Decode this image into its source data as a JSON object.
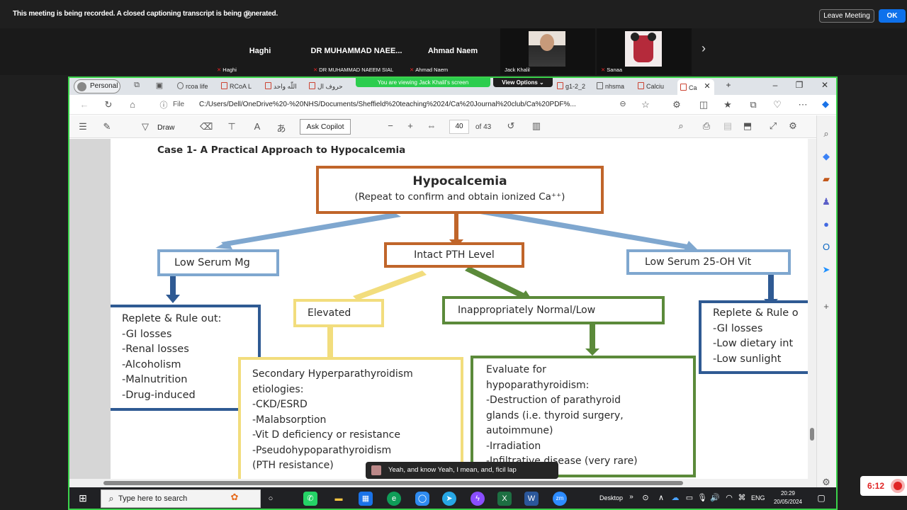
{
  "zoom": {
    "recording_notice": "This meeting is being recorded. A closed captioning transcript is being generated.",
    "leave_label": "Leave Meeting",
    "ok_label": "OK",
    "participants": [
      {
        "display_name": "Haghi",
        "label": "Haghi"
      },
      {
        "display_name": "DR MUHAMMAD NAEE...",
        "label": "DR MUHAMMAD NAEEM SIAL"
      },
      {
        "display_name": "Ahmad Naem",
        "label": "Ahmad Naem"
      },
      {
        "display_name": "",
        "label": "Jack Khalil"
      },
      {
        "display_name": "",
        "label": "Sanaa"
      }
    ],
    "viewing_text": "You are viewing  Jack Khalil's screen",
    "view_options": "View Options",
    "timer": "6:12",
    "caption": "Yeah, and know Yeah, I mean, and, ficil lap"
  },
  "browser": {
    "profile": "Personal",
    "tabs": [
      "rcoa life",
      "RCoA L",
      "اللّٰه واحد",
      "حروف ال",
      "g1-2_2",
      "nhsma",
      "Calciu",
      "Ca"
    ],
    "file_label": "File",
    "url": "C:/Users/Dell/OneDrive%20-%20NHS/Documents/Sheffield%20teaching%2024/Ca%20Journal%20club/Ca%20PDF%...",
    "toolbar": {
      "draw": "Draw",
      "ask_copilot": "Ask Copilot",
      "page_current": "40",
      "page_total": "of 43"
    }
  },
  "document": {
    "heading": "Case 1- A Practical Approach to Hypocalcemia",
    "root_title": "Hypocalcemia",
    "root_sub": "(Repeat to confirm and obtain ionized Ca⁺⁺)",
    "node_mg": "Low Serum Mg",
    "node_pth": "Intact PTH Level",
    "node_vit": "Low Serum 25-OH Vit",
    "node_elevated": "Elevated",
    "node_normal_low": "Inappropriately Normal/Low",
    "box_mg": "Replete & Rule out:\n-GI losses\n-Renal losses\n-Alcoholism\n-Malnutrition\n-Drug-induced",
    "box_secondary": "Secondary Hyperparathyroidism\netiologies:\n-CKD/ESRD\n-Malabsorption\n-Vit D deficiency or resistance\n-Pseudohypoparathyroidism\n(PTH resistance)",
    "box_hypo": "Evaluate for\nhypoparathyroidism:\n-Destruction of parathyroid\nglands (i.e. thyroid surgery,\nautoimmune)\n-Irradiation\n-Infiltrative disease (very rare)",
    "box_vit": "Replete & Rule o\n-GI losses\n-Low dietary int\n-Low sunlight"
  },
  "taskbar": {
    "search_placeholder": "Type here to search",
    "desktop": "Desktop",
    "lang": "ENG",
    "time": "20:29",
    "date": "20/05/2024"
  },
  "colors": {
    "orange": "#c0652a",
    "blue": "#7fa7cf",
    "navy": "#2f5a93",
    "yellow": "#f2dd7d",
    "green": "#5b8a3a",
    "zoom_green": "#2ccd4e"
  }
}
